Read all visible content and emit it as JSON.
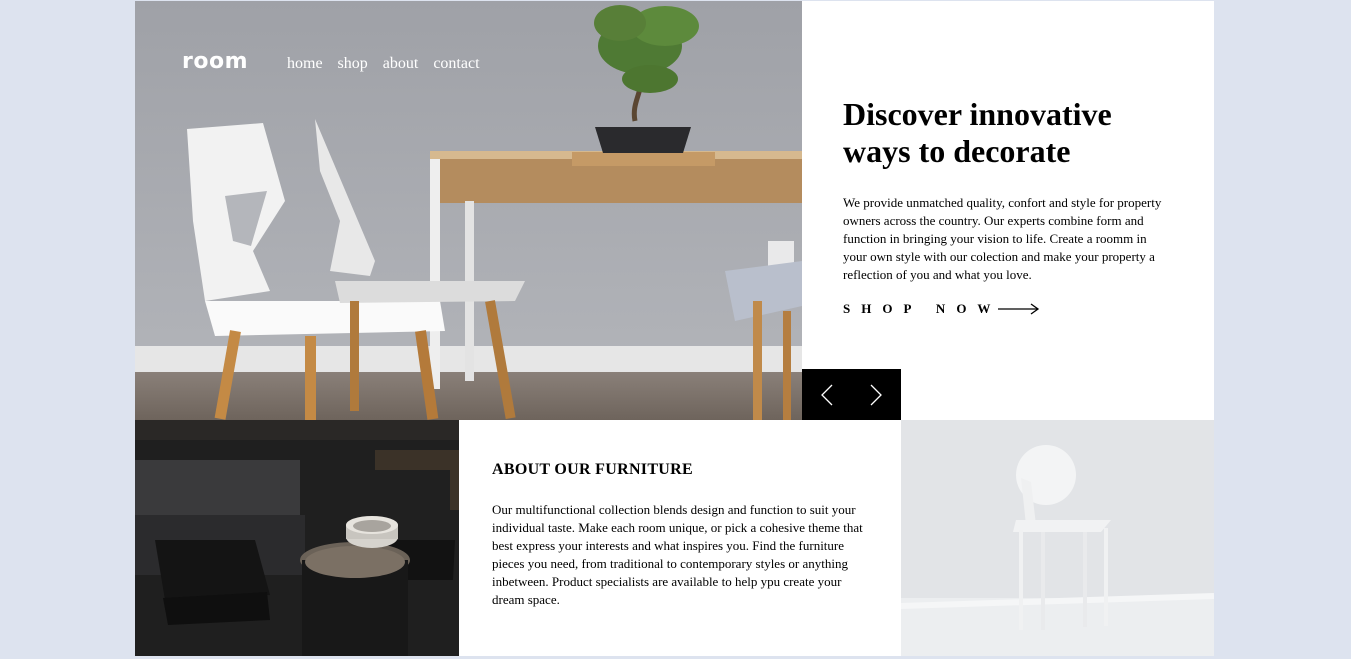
{
  "header": {
    "logo": "room",
    "nav": [
      "home",
      "shop",
      "about",
      "contact"
    ]
  },
  "hero": {
    "title": "Discover innovative ways to decorate",
    "description": "We provide unmatched quality, confort and style for property owners across the country. Our experts combine form and function in bringing your vision to life. Create a roomm in your own style with our colection and make your property a reflection of you and what you love.",
    "cta_label": "SHOP NOW",
    "cta_icon": "arrow-right-icon",
    "prev_icon": "chevron-left-icon",
    "next_icon": "chevron-right-icon"
  },
  "about": {
    "title": "ABOUT OUR FURNITURE",
    "description": "Our multifunctional collection blends design and function to suit your individual taste. Make each room unique, or pick a cohesive theme that best express your interests and what inspires you. Find the furniture pieces you need, from traditional to contemporary styles or anything inbetween. Product specialists are available to help ypu create your dream space."
  },
  "colors": {
    "page_background": "#dde3ef",
    "content_background": "#ffffff",
    "slider_controls": "#000000",
    "text": "#000000"
  }
}
